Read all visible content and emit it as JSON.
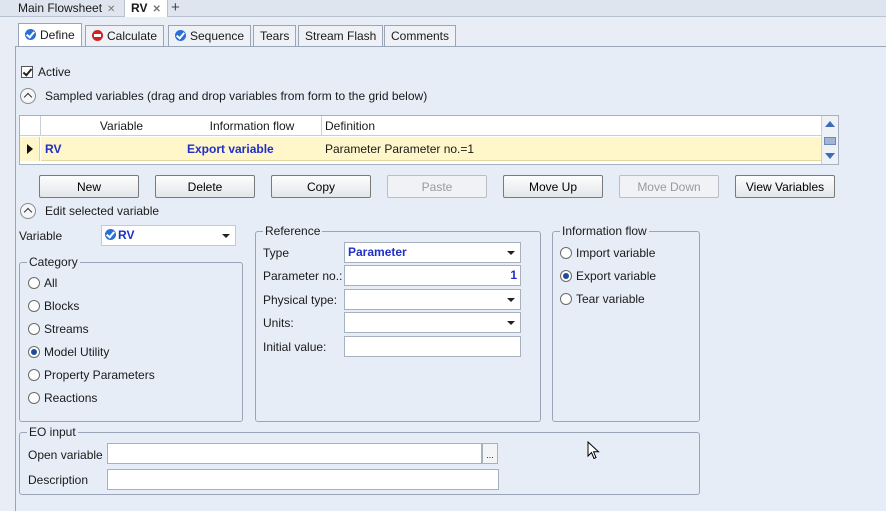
{
  "doc_tabs": [
    {
      "label": "Main Flowsheet",
      "active": false
    },
    {
      "label": "RV",
      "active": true
    }
  ],
  "form_tabs": [
    {
      "label": "Define",
      "icon": "check-circle-icon",
      "active": true
    },
    {
      "label": "Calculate",
      "icon": "red-circle-icon",
      "active": false
    },
    {
      "label": "Sequence",
      "icon": "check-circle-icon",
      "active": false
    },
    {
      "label": "Tears",
      "icon": "",
      "active": false
    },
    {
      "label": "Stream Flash",
      "icon": "",
      "active": false
    },
    {
      "label": "Comments",
      "icon": "",
      "active": false
    }
  ],
  "active_label": "Active",
  "active_checked": true,
  "sampled_header": "Sampled variables (drag and drop variables from form to the grid below)",
  "grid": {
    "columns": [
      "Variable",
      "Information flow",
      "Definition"
    ],
    "rows": [
      {
        "variable": "RV",
        "flow": "Export variable",
        "definition": "Parameter Parameter no.=1"
      }
    ]
  },
  "buttons": [
    {
      "label": "New",
      "enabled": true
    },
    {
      "label": "Delete",
      "enabled": true
    },
    {
      "label": "Copy",
      "enabled": true
    },
    {
      "label": "Paste",
      "enabled": false
    },
    {
      "label": "Move Up",
      "enabled": true
    },
    {
      "label": "Move Down",
      "enabled": false
    },
    {
      "label": "View Variables",
      "enabled": true
    }
  ],
  "edit_header": "Edit selected variable",
  "variable_label": "Variable",
  "variable_value": "RV",
  "category": {
    "title": "Category",
    "options": [
      "All",
      "Blocks",
      "Streams",
      "Model Utility",
      "Property Parameters",
      "Reactions"
    ],
    "selected": "Model Utility"
  },
  "reference": {
    "title": "Reference",
    "type_label": "Type",
    "type_value": "Parameter",
    "param_label": "Parameter no.:",
    "param_value": "1",
    "phys_label": "Physical type:",
    "phys_value": "",
    "units_label": "Units:",
    "units_value": "",
    "init_label": "Initial value:",
    "init_value": ""
  },
  "info_flow": {
    "title": "Information flow",
    "options": [
      "Import variable",
      "Export variable",
      "Tear variable"
    ],
    "selected": "Export variable"
  },
  "eo_input": {
    "title": "EO input",
    "open_label": "Open variable",
    "open_value": "",
    "browse_label": "...",
    "desc_label": "Description",
    "desc_value": ""
  },
  "colors": {
    "accent_text": "#1f2fc7",
    "selected_row": "#fff7c9"
  }
}
